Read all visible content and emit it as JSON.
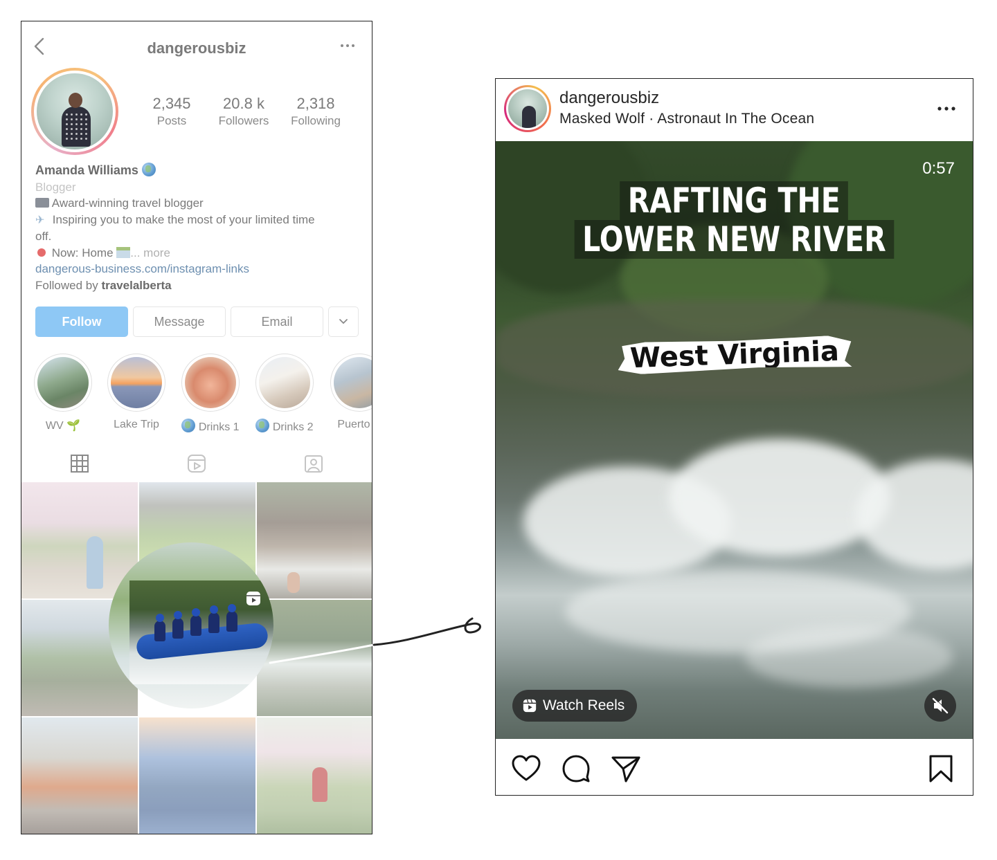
{
  "profile": {
    "handle": "dangerousbiz",
    "stats": [
      {
        "value": "2,345",
        "label": "Posts"
      },
      {
        "value": "20.8 k",
        "label": "Followers"
      },
      {
        "value": "2,318",
        "label": "Following"
      }
    ],
    "name": "Amanda Williams",
    "category": "Blogger",
    "bio_line1": "Award-winning travel blogger",
    "bio_line2": "Inspiring you to make the most of your limited time",
    "bio_line2b": "off.",
    "bio_line3": "Now: Home",
    "more": "... more",
    "link": "dangerous-business.com/instagram-links",
    "followed_by_prefix": "Followed by",
    "followed_by_user": "travelalberta",
    "buttons": {
      "follow": "Follow",
      "message": "Message",
      "email": "Email"
    },
    "highlights": [
      {
        "label": "WV 🌱"
      },
      {
        "label": "Lake Trip"
      },
      {
        "label": "Drinks 1"
      },
      {
        "label": "Drinks 2"
      },
      {
        "label": "Puerto R"
      }
    ],
    "icons": {
      "back": "chevron-left-icon",
      "more": "more-horizontal-icon",
      "grid": "grid-icon",
      "reels": "reels-icon",
      "tagged": "tagged-icon"
    }
  },
  "post": {
    "user": "dangerousbiz",
    "audio": "Masked Wolf · Astronaut In The Ocean",
    "timer": "0:57",
    "title_line1": "RAFTING THE",
    "title_line2": "LOWER NEW RIVER",
    "subtitle": "West Virginia",
    "watch_reels": "Watch Reels",
    "icons": {
      "like": "heart-icon",
      "comment": "comment-icon",
      "share": "send-icon",
      "save": "bookmark-icon",
      "mute": "muted-speaker-icon",
      "more": "more-horizontal-icon"
    }
  },
  "colors": {
    "follow_button": "#8ec8f5",
    "link": "#6d8fb0",
    "ring_gradient_start": "#f5c04f",
    "ring_gradient_end": "#d6287d"
  }
}
